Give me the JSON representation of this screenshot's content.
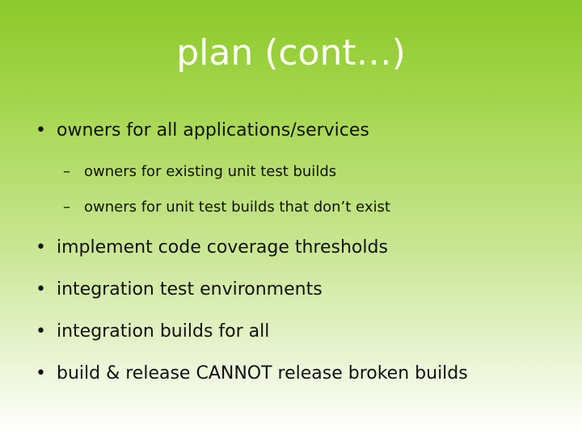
{
  "slide": {
    "title": "plan (cont…)",
    "bullets": [
      {
        "level": 1,
        "text": "owners for all applications/services"
      },
      {
        "level": 2,
        "text": "owners for existing unit test builds"
      },
      {
        "level": 2,
        "text": "owners for unit test builds that don’t exist"
      },
      {
        "level": 1,
        "text": "implement code coverage thresholds"
      },
      {
        "level": 1,
        "text": "integration test environments"
      },
      {
        "level": 1,
        "text": "integration builds for all"
      },
      {
        "level": 1,
        "text": "build & release CANNOT release broken builds"
      }
    ]
  },
  "colors": {
    "background_top": "#8cc92a",
    "background_bottom": "#ffffff",
    "title": "#ffffff",
    "text": "#111111"
  }
}
